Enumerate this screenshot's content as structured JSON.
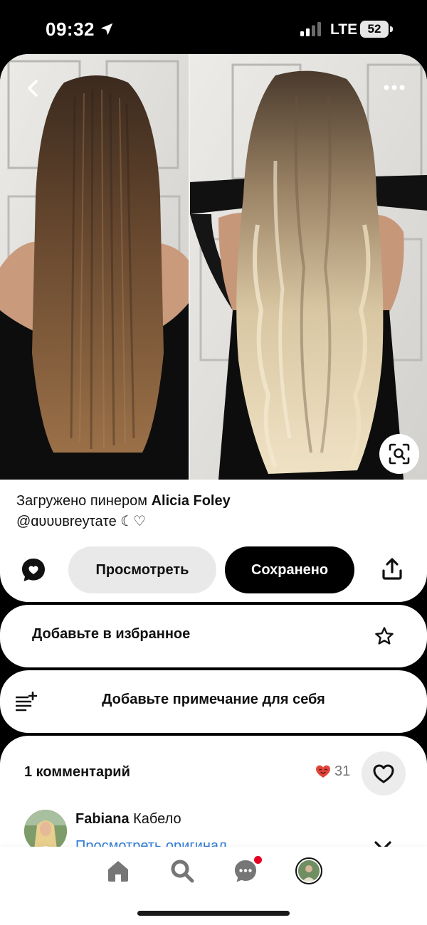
{
  "status_bar": {
    "time": "09:32",
    "network": "LTE",
    "battery": "52"
  },
  "pin": {
    "icons": {
      "back": "chevron-left-icon",
      "more": "more-horizontal-icon",
      "lens": "visual-search-icon"
    },
    "caption": {
      "prefix": "Загружено пинером",
      "author": "Alicia Foley",
      "handle_line": "@ɑυυυвreуτаτе ☾♡"
    },
    "actions": {
      "view_label": "Просмотреть",
      "saved_label": "Сохранено"
    }
  },
  "favorites": {
    "label": "Добавьте в избранное"
  },
  "note": {
    "label": "Добавьте примечание для себя"
  },
  "comments": {
    "title": "1 комментарий",
    "reaction_count": "31",
    "first_comment": {
      "author": "Fabiana",
      "text": "Кабело",
      "link": "Просмотреть оригинал"
    }
  },
  "tab_bar": {
    "items": [
      "home-icon",
      "search-icon",
      "messages-icon",
      "profile-avatar"
    ]
  },
  "colors": {
    "accent_red": "#e60023",
    "link_blue": "#2f7bd5",
    "saved_button": "#000000",
    "view_button": "#e9e9e9"
  }
}
